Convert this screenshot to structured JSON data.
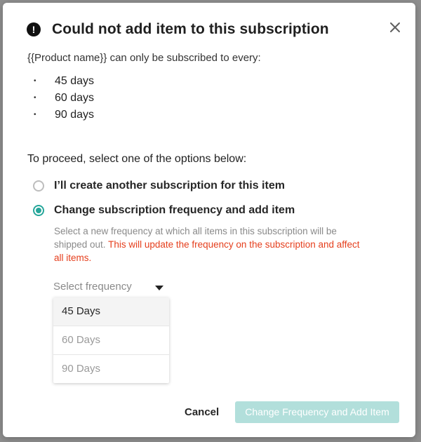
{
  "dialog": {
    "title": "Could not add item to this subscription",
    "intro": "{{Product name}} can only be subscribed to every:",
    "day_options": [
      "45 days",
      "60 days",
      "90 days"
    ],
    "proceed_text": "To proceed, select one of the options below:",
    "options": [
      {
        "label": "I’ll create another subscription for this item",
        "selected": false
      },
      {
        "label": "Change subscription frequency and add item",
        "selected": true
      }
    ],
    "description": "Select a new frequency at which all items in this subscription will be shipped out.",
    "warning": "This will update the frequency on the subscription and affect all items.",
    "select": {
      "placeholder": "Select frequency",
      "options": [
        "45 Days",
        "60 Days",
        "90 Days"
      ],
      "highlighted": "45 Days"
    },
    "buttons": {
      "cancel": "Cancel",
      "primary": "Change Frequency and Add Item"
    }
  },
  "colors": {
    "accent": "#26a69a",
    "warning": "#e53e1c",
    "disabled_button": "#b2dfdb"
  },
  "icons": {
    "alert": "exclamation-circle-icon",
    "close": "close-icon",
    "dropdown": "caret-down-icon"
  }
}
